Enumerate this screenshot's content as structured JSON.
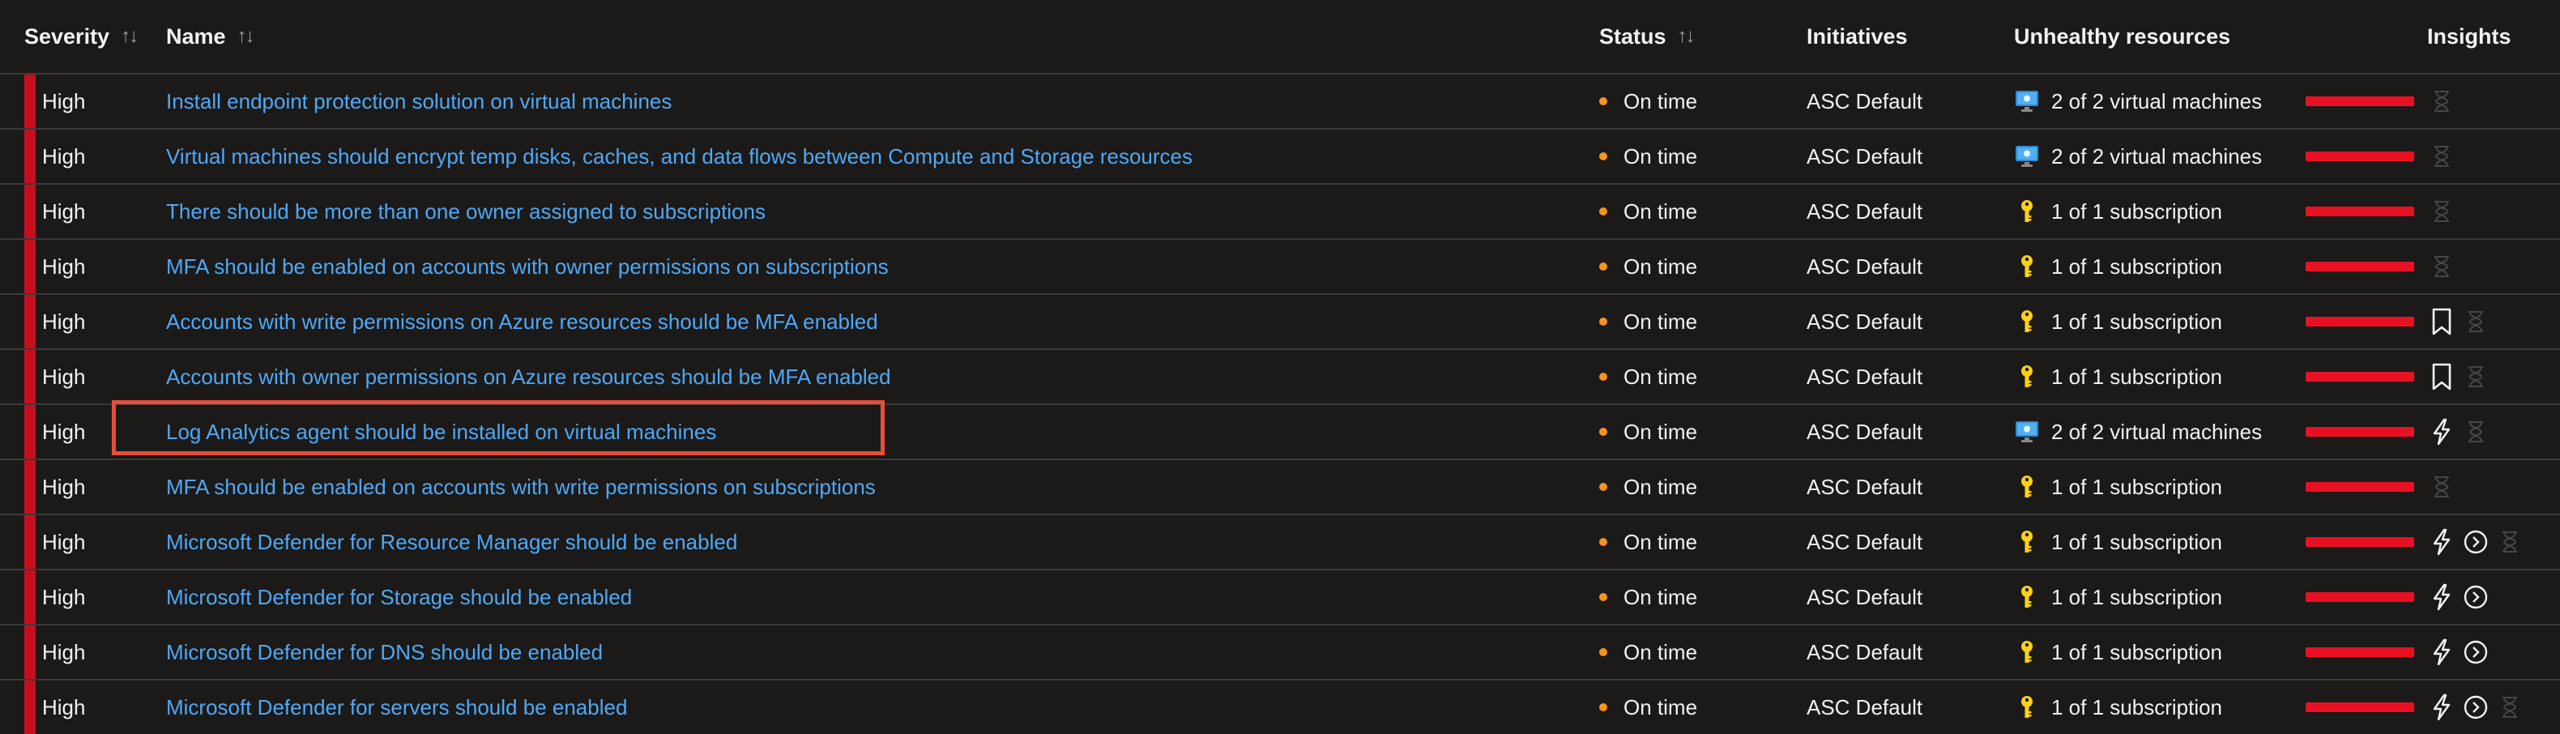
{
  "header": {
    "severity": "Severity",
    "name": "Name",
    "status": "Status",
    "initiatives": "Initiatives",
    "unhealthy_resources": "Unhealthy resources",
    "insights": "Insights",
    "sort_glyph": "↑↓"
  },
  "colors": {
    "severity_high": "#c50f1f",
    "link": "#4fa8f5",
    "status_dot": "#f7941d",
    "unhealthy_bar": "#e81123",
    "highlight_box": "#e74c3c"
  },
  "rows": [
    {
      "severity": "High",
      "name": "Install endpoint protection solution on virtual machines",
      "status": "On time",
      "initiative": "ASC Default",
      "resource_icon": "virtual-machine-icon",
      "resources": "2 of 2 virtual machines",
      "insights": [
        "hourglass-icon"
      ]
    },
    {
      "severity": "High",
      "name": "Virtual machines should encrypt temp disks, caches, and data flows between Compute and Storage resources",
      "status": "On time",
      "initiative": "ASC Default",
      "resource_icon": "virtual-machine-icon",
      "resources": "2 of 2 virtual machines",
      "insights": [
        "hourglass-icon"
      ]
    },
    {
      "severity": "High",
      "name": "There should be more than one owner assigned to subscriptions",
      "status": "On time",
      "initiative": "ASC Default",
      "resource_icon": "subscription-key-icon",
      "resources": "1 of 1 subscription",
      "insights": [
        "hourglass-icon"
      ]
    },
    {
      "severity": "High",
      "name": "MFA should be enabled on accounts with owner permissions on subscriptions",
      "status": "On time",
      "initiative": "ASC Default",
      "resource_icon": "subscription-key-icon",
      "resources": "1 of 1 subscription",
      "insights": [
        "hourglass-icon"
      ]
    },
    {
      "severity": "High",
      "name": "Accounts with write permissions on Azure resources should be MFA enabled",
      "status": "On time",
      "initiative": "ASC Default",
      "resource_icon": "subscription-key-icon",
      "resources": "1 of 1 subscription",
      "insights": [
        "bookmark-icon",
        "hourglass-icon"
      ]
    },
    {
      "severity": "High",
      "name": "Accounts with owner permissions on Azure resources should be MFA enabled",
      "status": "On time",
      "initiative": "ASC Default",
      "resource_icon": "subscription-key-icon",
      "resources": "1 of 1 subscription",
      "insights": [
        "bookmark-icon",
        "hourglass-icon"
      ]
    },
    {
      "severity": "High",
      "name": "Log Analytics agent should be installed on virtual machines",
      "status": "On time",
      "initiative": "ASC Default",
      "resource_icon": "virtual-machine-icon",
      "resources": "2 of 2 virtual machines",
      "insights": [
        "quick-fix-icon",
        "hourglass-icon"
      ],
      "highlighted": true
    },
    {
      "severity": "High",
      "name": "MFA should be enabled on accounts with write permissions on subscriptions",
      "status": "On time",
      "initiative": "ASC Default",
      "resource_icon": "subscription-key-icon",
      "resources": "1 of 1 subscription",
      "insights": [
        "hourglass-icon"
      ]
    },
    {
      "severity": "High",
      "name": "Microsoft Defender for Resource Manager should be enabled",
      "status": "On time",
      "initiative": "ASC Default",
      "resource_icon": "subscription-key-icon",
      "resources": "1 of 1 subscription",
      "insights": [
        "quick-fix-icon",
        "chevron-circle-icon",
        "hourglass-icon"
      ]
    },
    {
      "severity": "High",
      "name": "Microsoft Defender for Storage should be enabled",
      "status": "On time",
      "initiative": "ASC Default",
      "resource_icon": "subscription-key-icon",
      "resources": "1 of 1 subscription",
      "insights": [
        "quick-fix-icon",
        "chevron-circle-icon"
      ]
    },
    {
      "severity": "High",
      "name": "Microsoft Defender for DNS should be enabled",
      "status": "On time",
      "initiative": "ASC Default",
      "resource_icon": "subscription-key-icon",
      "resources": "1 of 1 subscription",
      "insights": [
        "quick-fix-icon",
        "chevron-circle-icon"
      ]
    },
    {
      "severity": "High",
      "name": "Microsoft Defender for servers should be enabled",
      "status": "On time",
      "initiative": "ASC Default",
      "resource_icon": "subscription-key-icon",
      "resources": "1 of 1 subscription",
      "insights": [
        "quick-fix-icon",
        "chevron-circle-icon",
        "hourglass-icon"
      ]
    }
  ]
}
